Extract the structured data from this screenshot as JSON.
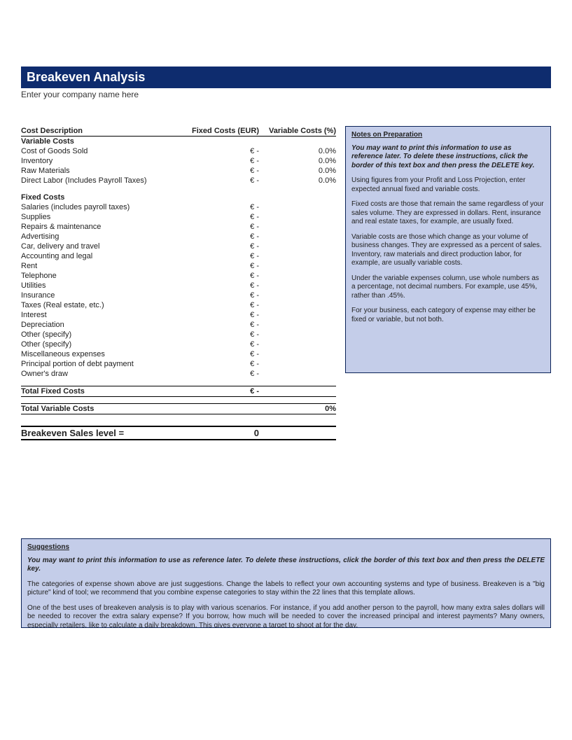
{
  "header": {
    "title": "Breakeven Analysis",
    "company_name": "Enter your company name here"
  },
  "columns": {
    "desc": "Cost Description",
    "fixed": "Fixed Costs (EUR)",
    "variable": "Variable Costs (%)"
  },
  "sections": {
    "variable_label": "Variable Costs",
    "fixed_label": "Fixed Costs"
  },
  "variable_rows": [
    {
      "label": "Cost of Goods Sold",
      "fixed": "€ -",
      "var": "0.0%"
    },
    {
      "label": "Inventory",
      "fixed": "€ -",
      "var": "0.0%"
    },
    {
      "label": "Raw Materials",
      "fixed": "€ -",
      "var": "0.0%"
    },
    {
      "label": "Direct Labor (Includes Payroll Taxes)",
      "fixed": "€ -",
      "var": "0.0%"
    }
  ],
  "fixed_rows": [
    {
      "label": "Salaries (includes payroll taxes)",
      "fixed": "€ -"
    },
    {
      "label": "Supplies",
      "fixed": "€ -"
    },
    {
      "label": "Repairs & maintenance",
      "fixed": "€ -"
    },
    {
      "label": "Advertising",
      "fixed": "€ -"
    },
    {
      "label": "Car, delivery and travel",
      "fixed": "€ -"
    },
    {
      "label": "Accounting and legal",
      "fixed": "€ -"
    },
    {
      "label": "Rent",
      "fixed": "€ -"
    },
    {
      "label": "Telephone",
      "fixed": "€ -"
    },
    {
      "label": "Utilities",
      "fixed": "€ -"
    },
    {
      "label": "Insurance",
      "fixed": "€ -"
    },
    {
      "label": "Taxes (Real estate, etc.)",
      "fixed": "€ -"
    },
    {
      "label": "Interest",
      "fixed": "€ -"
    },
    {
      "label": "Depreciation",
      "fixed": "€ -"
    },
    {
      "label": "Other (specify)",
      "fixed": "€ -"
    },
    {
      "label": "Other (specify)",
      "fixed": "€ -"
    },
    {
      "label": "Miscellaneous expenses",
      "fixed": "€ -"
    },
    {
      "label": "Principal portion of debt payment",
      "fixed": "€ -"
    },
    {
      "label": "Owner's draw",
      "fixed": "€ -"
    }
  ],
  "totals": {
    "fixed_label": "Total Fixed Costs",
    "fixed_value": "€ -",
    "variable_label": "Total Variable Costs",
    "variable_value": "0%",
    "breakeven_label": "Breakeven Sales level  =",
    "breakeven_value": "0"
  },
  "notes": {
    "title": "Notes on Preparation",
    "p1": "You may want to print this information to use as reference later. To delete these instructions, click the border of this text box and then press the DELETE key.",
    "p2": "Using figures from your Profit and Loss Projection, enter expected annual fixed and variable costs.",
    "p3": "Fixed costs are those that remain the same regardless of your sales volume. They are expressed in dollars. Rent, insurance and real estate taxes, for example, are usually fixed.",
    "p4": "Variable costs are those which change as your volume of business changes. They are expressed as a percent of sales. Inventory, raw materials and direct production labor, for example, are usually variable costs.",
    "p5": "Under the variable expenses column, use whole numbers as a percentage, not decimal numbers. For example, use 45%, rather than .45%.",
    "p6": "For your business, each category of expense may either be fixed or variable, but not both."
  },
  "suggestions": {
    "title": "Suggestions",
    "p1": "You may want to print this information to use as reference later. To delete these instructions, click the border of this text box and then press the DELETE key.",
    "p2": "The categories of expense shown above are just suggestions. Change the labels to reflect your own accounting systems and type of business. Breakeven is a \"big picture\" kind of tool; we recommend that you combine expense categories to stay within the 22 lines that this template allows.",
    "p3": "One of the best uses of breakeven analysis is to play with various scenarios. For instance, if you add another person to the payroll, how many extra sales dollars will be needed to recover the extra salary expense? If you borrow, how much will be needed to cover the increased principal and interest payments? Many owners, especially retailers, like to calculate a daily breakdown. This gives everyone a target to shoot at for the day."
  }
}
